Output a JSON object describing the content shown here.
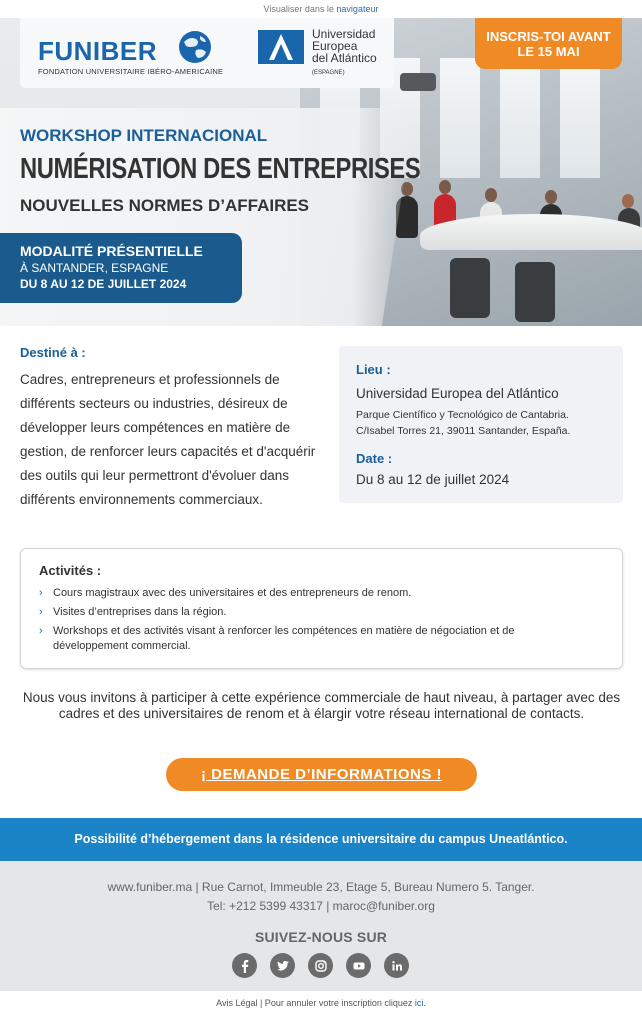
{
  "topbar": {
    "text": "Visualiser dans le ",
    "link": "navigateur"
  },
  "header": {
    "funiber_word": "FUNIBER",
    "funiber_sub": "FONDATION UNIVERSITAIRE IBÉRO-AMERICAINE",
    "uea_line1": "Universidad",
    "uea_line2": "Europea",
    "uea_line3": "del Atlántico",
    "uea_sub": "(ESPAGNE)",
    "cta_line1": "INSCRIS-TOI AVANT",
    "cta_line2": "LE 15 MAI"
  },
  "hero": {
    "workshop": "WORKSHOP INTERNACIONAL",
    "title1": "NUMÉRISATION DES ENTREPRISES",
    "title2": "NOUVELLES NORMES D’AFFAIRES",
    "mode1": "MODALITÉ PRÉSENTIELLE",
    "mode2": "À SANTANDER, ESPAGNE",
    "mode3": "DU 8 AU 12 DE JUILLET 2024"
  },
  "destine": {
    "label": "Destiné à :",
    "text": "Cadres, entrepreneurs et professionnels de différents secteurs ou industries, désireux de développer leurs compétences en matière de gestion, de renforcer leurs capacités et d'acquérir des outils qui leur permettront d'évoluer dans différents environnements commerciaux."
  },
  "info": {
    "lieu_label": "Lieu :",
    "lieu_name": "Universidad Europea del Atlántico",
    "lieu_addr1": "Parque Científico y Tecnológico de Cantabria.",
    "lieu_addr2": "C/Isabel Torres 21, 39011 Santander, España.",
    "date_label": "Date :",
    "date_value": "Du 8 au 12 de juillet 2024"
  },
  "activities": {
    "label": "Activités :",
    "items": [
      "Cours magistraux avec des universitaires et des entrepreneurs de renom.",
      "Visites d’entreprises dans la région.",
      "Workshops et des activités visant à renforcer les compétences en matière de négociation et de développement commercial."
    ]
  },
  "invite": "Nous vous invitons à participer à cette expérience commerciale de haut niveau, à partager avec des cadres et des universitaires de renom et à élargir votre réseau international de contacts.",
  "cta_button": "¡ DEMANDE D’INFORMATIONS !",
  "band": "Possibilité d’hébergement dans la résidence universitaire du campus Uneatlántico.",
  "footer": {
    "addr1": "www.funiber.ma | Rue Carnot, Immeuble 23, Etage 5, Bureau Numero 5. Tanger.",
    "addr2": "Tel: +212 5399 43317 | maroc@funiber.org",
    "follow": "SUIVEZ-NOUS SUR",
    "icons": [
      "facebook-icon",
      "twitter-icon",
      "instagram-icon",
      "youtube-icon",
      "linkedin-icon"
    ]
  },
  "legal": {
    "text": "Avis Légal | Pour annuler votre inscription cliquez ",
    "link": "ici."
  },
  "colors": {
    "blue": "#1a5f99",
    "orange": "#f08a24",
    "band": "#1a84c6"
  }
}
